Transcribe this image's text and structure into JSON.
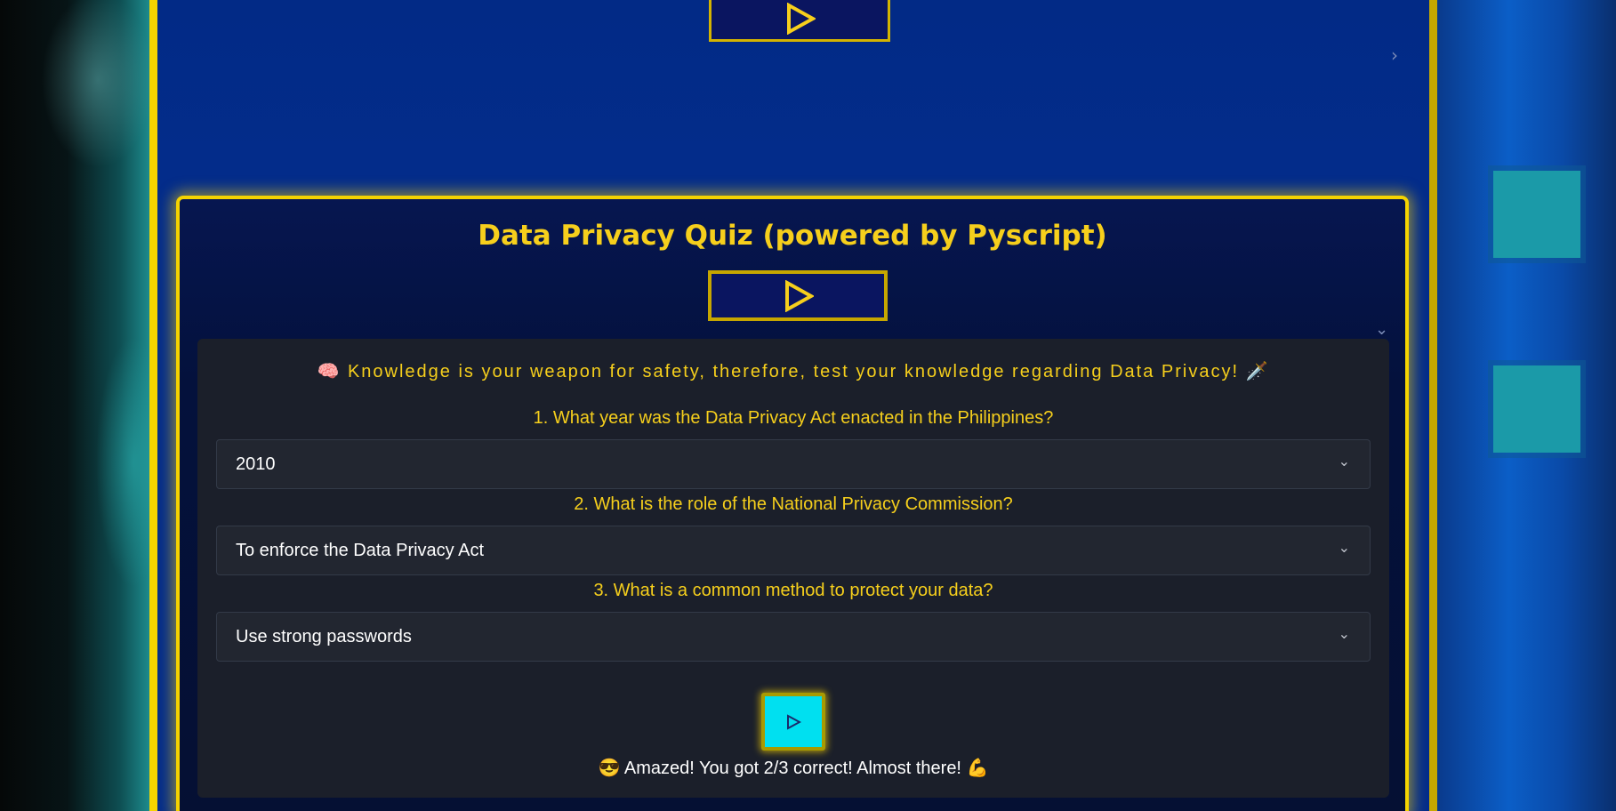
{
  "page": {
    "accent_color": "#f6cf1c",
    "frame_border_color": "#f5d400",
    "panel_background": "#1b1f2a"
  },
  "top_section": {
    "play_icon": "play-outline-icon",
    "collapse_icon": "chevron-right-icon"
  },
  "quiz": {
    "title": "Data Privacy Quiz (powered by Pyscript)",
    "play_icon": "play-outline-icon",
    "expand_icon": "chevron-down-icon",
    "tagline_prefix_emoji": "🧠",
    "tagline": "Knowledge is your weapon for safety, therefore, test your knowledge regarding Data Privacy!",
    "tagline_suffix_emoji": "🗡️",
    "questions": [
      {
        "label": "1. What year was the Data Privacy Act enacted in the Philippines?",
        "selected": "2010"
      },
      {
        "label": "2. What is the role of the National Privacy Commission?",
        "selected": "To enforce the Data Privacy Act"
      },
      {
        "label": "3. What is a common method to protect your data?",
        "selected": "Use strong passwords"
      }
    ],
    "submit_icon": "play-small-icon",
    "submit_color": "#00e0f0",
    "result_prefix_emoji": "😎",
    "result": "Amazed! You got 2/3 correct! Almost there!",
    "result_suffix_emoji": "💪"
  }
}
